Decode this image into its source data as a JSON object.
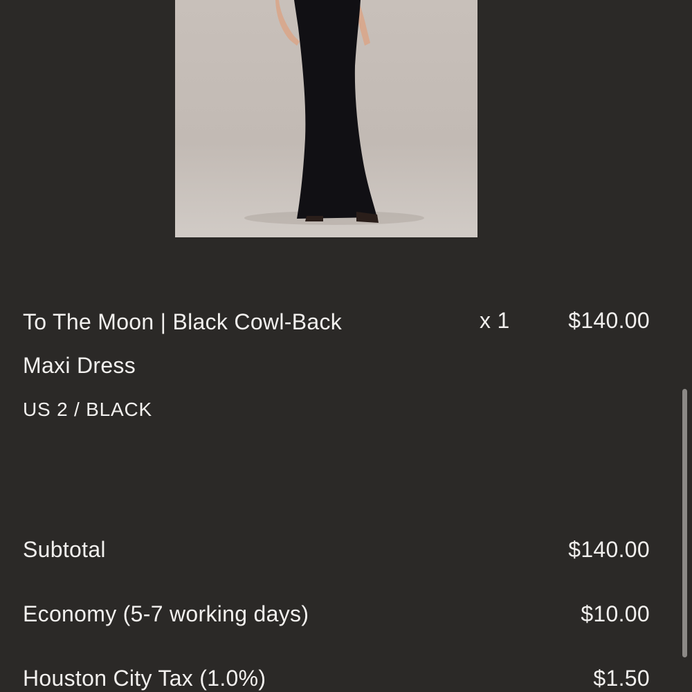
{
  "product": {
    "image_alt": "Model wearing black cowl-back maxi dress",
    "name_line1": "To The Moon | Black Cowl-Back",
    "name_line2": "Maxi Dress",
    "variant": "US 2 / BLACK",
    "quantity": "x 1",
    "price": "$140.00"
  },
  "summary": {
    "subtotal": {
      "label": "Subtotal",
      "value": "$140.00"
    },
    "shipping": {
      "label": "Economy (5-7 working days)",
      "value": "$10.00"
    },
    "tax": {
      "label": "Houston City Tax (1.0%)",
      "value": "$1.50"
    }
  },
  "colors": {
    "background": "#2b2927",
    "text": "#f2f0ee",
    "dress": "#111014",
    "image_backdrop": "#c9c2bd"
  }
}
